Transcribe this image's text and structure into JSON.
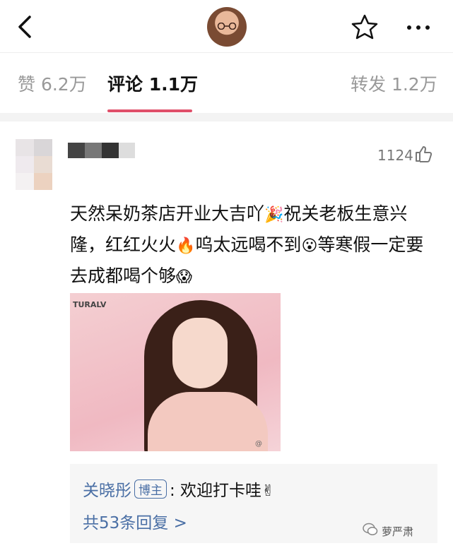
{
  "header": {
    "back_icon": "chevron-left-icon",
    "favorite_icon": "star-outline-icon",
    "more_icon": "ellipsis-icon"
  },
  "tabs": [
    {
      "label": "赞 6.2万"
    },
    {
      "label": "评论 1.1万"
    },
    {
      "label": "转发 1.2万"
    }
  ],
  "comment": {
    "likes": "1124",
    "text_parts": [
      "天然呆奶茶店开业大吉吖",
      "🎉",
      "祝关老板生意兴隆，红红火火",
      "🔥",
      "呜太远喝不到",
      "😮",
      "等寒假一定要去成都喝个够",
      "😱"
    ],
    "photo_brand": "TURALV",
    "photo_watermark": "@"
  },
  "reply": {
    "name": "关晓彤",
    "badge": "博主",
    "text": ": 欢迎打卡哇",
    "emoji": "✌",
    "more": "共53条回复 >"
  },
  "watermark": {
    "text": "萝严肃"
  },
  "colors": {
    "accent": "#e0506a",
    "link": "#4a6fa5"
  }
}
